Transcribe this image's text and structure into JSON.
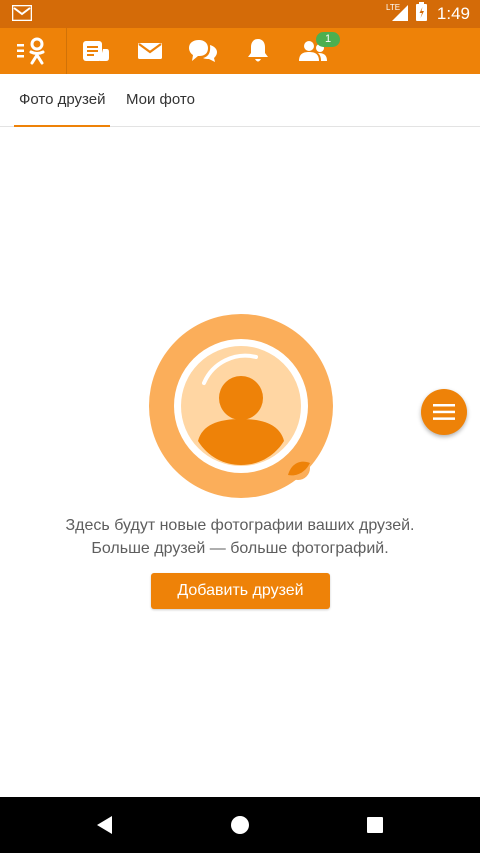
{
  "status_bar": {
    "time": "1:49",
    "network": "LTE",
    "icons": [
      "gmail-icon",
      "signal-icon",
      "battery-icon"
    ]
  },
  "app_bar": {
    "icons": [
      "ok-menu-icon",
      "feed-icon",
      "messages-icon",
      "discussions-icon",
      "notifications-icon",
      "friends-icon"
    ],
    "friends_badge": "1"
  },
  "tabs": [
    {
      "label": "Фото друзей",
      "active": true
    },
    {
      "label": "Мои фото",
      "active": false
    }
  ],
  "empty_state": {
    "line1": "Здесь будут новые фотографии ваших друзей.",
    "line2": "Больше друзей — больше фотографий.",
    "button_label": "Добавить друзей"
  },
  "colors": {
    "brand": "#ee8208",
    "status_bar": "#d46b08",
    "badge": "#4caf50"
  },
  "nav_bar": {
    "icons": [
      "back-icon",
      "home-icon",
      "recents-icon"
    ]
  }
}
